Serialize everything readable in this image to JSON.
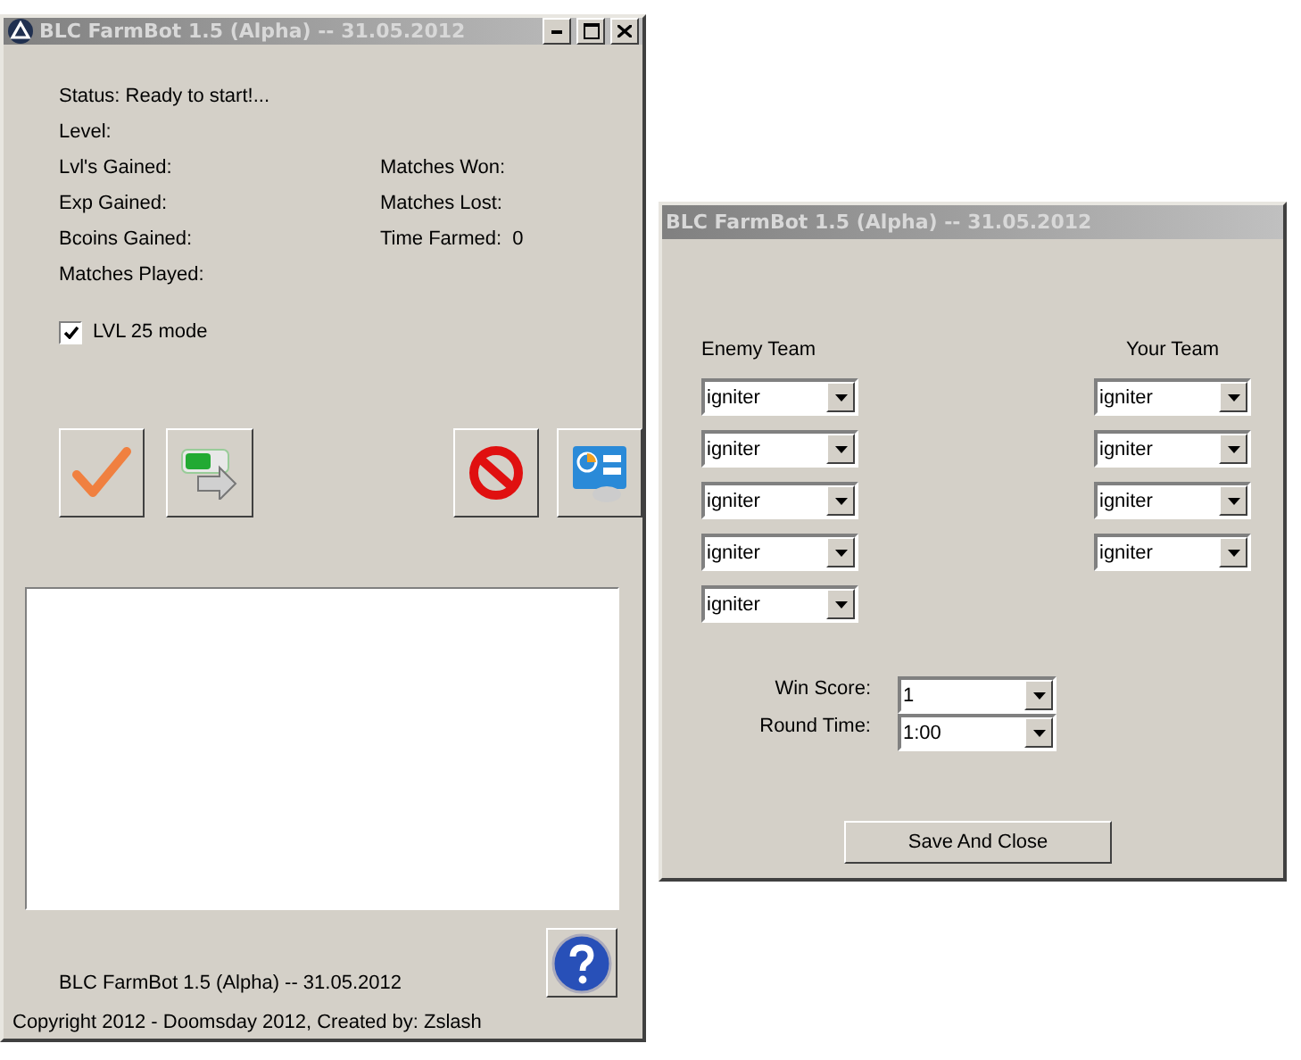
{
  "main_window": {
    "title": "BLC FarmBot 1.5 (Alpha) -- 31.05.2012",
    "status": "Status: Ready to start!...",
    "level_label": "Level:",
    "stats_left": [
      {
        "label": "Lvl's Gained:"
      },
      {
        "label": "Exp Gained:"
      },
      {
        "label": "Bcoins Gained:"
      },
      {
        "label": "Matches Played:"
      }
    ],
    "stats_right": [
      {
        "label": "Matches Won:"
      },
      {
        "label": "Matches Lost:"
      },
      {
        "label": "Time Farmed:",
        "value": "0"
      }
    ],
    "lvl25_mode": {
      "label": "LVL 25 mode",
      "checked": true
    },
    "toolbar": [
      {
        "kind": "start"
      },
      {
        "kind": "switch"
      },
      {
        "kind": "stop"
      },
      {
        "kind": "settings"
      }
    ],
    "footer_title": "BLC FarmBot 1.5 (Alpha) -- 31.05.2012",
    "copyright": "Copyright 2012 - Doomsday 2012, Created by: Zslash"
  },
  "settings_window": {
    "title": "BLC FarmBot 1.5 (Alpha) -- 31.05.2012",
    "enemy_team": {
      "label": "Enemy Team",
      "slots": [
        "igniter",
        "igniter",
        "igniter",
        "igniter",
        "igniter"
      ]
    },
    "your_team": {
      "label": "Your Team",
      "slots": [
        "igniter",
        "igniter",
        "igniter",
        "igniter"
      ]
    },
    "win_score": {
      "label": "Win Score:",
      "value": "1"
    },
    "round_time": {
      "label": "Round Time:",
      "value": "1:00"
    },
    "save_button": "Save And Close"
  }
}
